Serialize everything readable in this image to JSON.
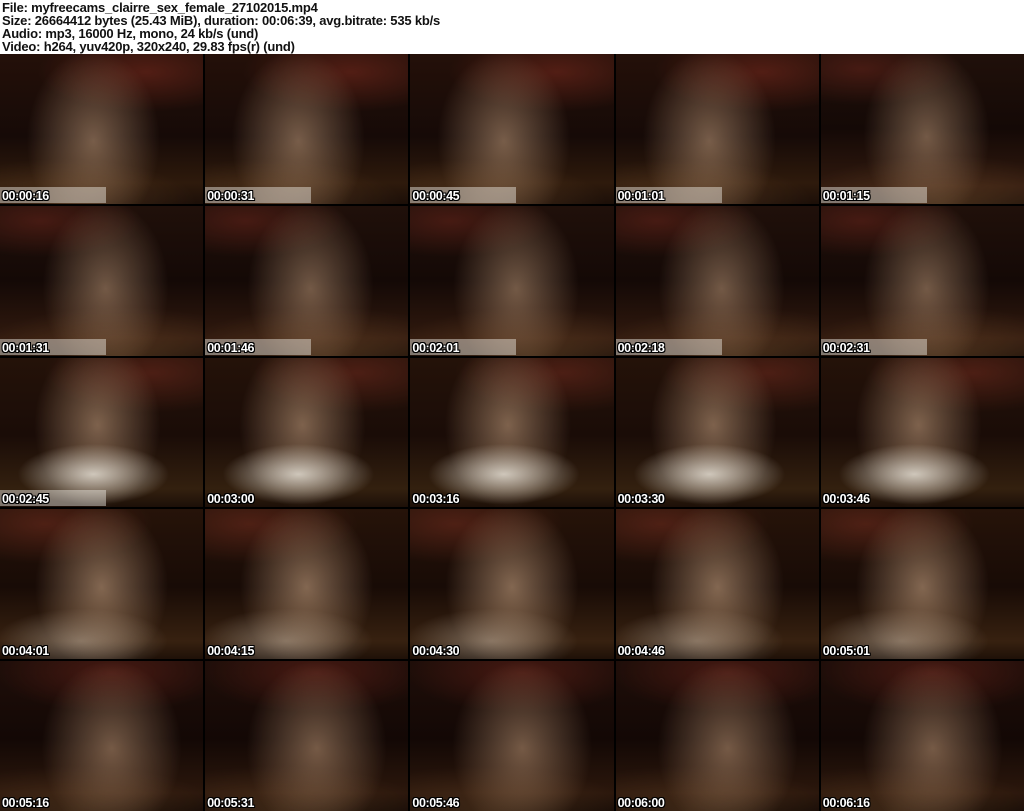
{
  "header": {
    "lines": [
      "File: myfreecams_clairre_sex_female_27102015.mp4",
      "Size: 26664412 bytes (25.43 MiB), duration: 00:06:39, avg.bitrate: 535 kb/s",
      "Audio: mp3, 16000 Hz, mono, 24 kb/s (und)",
      "Video: h264, yuv420p, 320x240, 29.83 fps(r) (und)"
    ]
  },
  "grid": {
    "columns": 5,
    "rows": 5
  },
  "thumbnails": [
    {
      "time": "00:00:16",
      "tone": "t1",
      "strip": true
    },
    {
      "time": "00:00:31",
      "tone": "t1",
      "strip": true
    },
    {
      "time": "00:00:45",
      "tone": "t1",
      "strip": true
    },
    {
      "time": "00:01:01",
      "tone": "t1",
      "strip": true
    },
    {
      "time": "00:01:15",
      "tone": "t2",
      "strip": true
    },
    {
      "time": "00:01:31",
      "tone": "t2",
      "strip": true
    },
    {
      "time": "00:01:46",
      "tone": "t2",
      "strip": true
    },
    {
      "time": "00:02:01",
      "tone": "t2",
      "strip": true
    },
    {
      "time": "00:02:18",
      "tone": "t2",
      "strip": true
    },
    {
      "time": "00:02:31",
      "tone": "t2",
      "strip": true
    },
    {
      "time": "00:02:45",
      "tone": "t3",
      "strip": true
    },
    {
      "time": "00:03:00",
      "tone": "t3",
      "strip": false
    },
    {
      "time": "00:03:16",
      "tone": "t3",
      "strip": false
    },
    {
      "time": "00:03:30",
      "tone": "t3",
      "strip": false
    },
    {
      "time": "00:03:46",
      "tone": "t3",
      "strip": false
    },
    {
      "time": "00:04:01",
      "tone": "t4",
      "strip": false
    },
    {
      "time": "00:04:15",
      "tone": "t4",
      "strip": false
    },
    {
      "time": "00:04:30",
      "tone": "t4",
      "strip": false
    },
    {
      "time": "00:04:46",
      "tone": "t4",
      "strip": false
    },
    {
      "time": "00:05:01",
      "tone": "t4",
      "strip": false
    },
    {
      "time": "00:05:16",
      "tone": "t5",
      "strip": false
    },
    {
      "time": "00:05:31",
      "tone": "t5",
      "strip": false
    },
    {
      "time": "00:05:46",
      "tone": "t5",
      "strip": false
    },
    {
      "time": "00:06:00",
      "tone": "t5",
      "strip": false
    },
    {
      "time": "00:06:16",
      "tone": "t5",
      "strip": false
    }
  ],
  "colors": {
    "header_bg": "#ffffff",
    "header_text": "#111111",
    "sheet_bg": "#000000",
    "timestamp_text": "#ffffff",
    "scene_dark": "#160a07",
    "scene_brown": "#2e1a0c",
    "scene_skin": "#d6ae8a",
    "scene_red": "#6e231c",
    "scene_strip": "#f2efe8"
  }
}
